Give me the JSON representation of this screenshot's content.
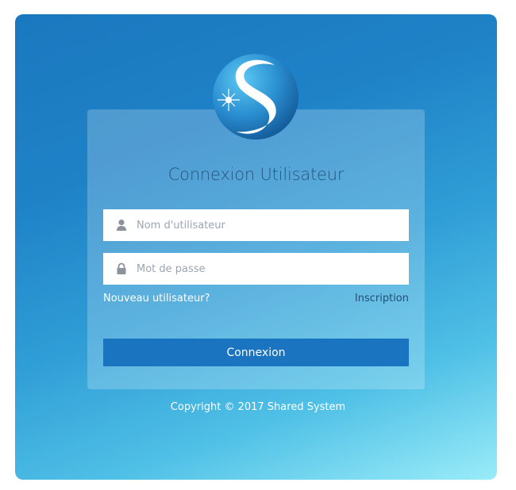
{
  "login": {
    "title": "Connexion Utilisateur",
    "username_placeholder": "Nom d'utilisateur",
    "password_placeholder": "Mot de passe",
    "new_user_link": "Nouveau utilisateur?",
    "signup_link": "Inscription",
    "submit_label": "Connexion"
  },
  "footer": {
    "copyright": "Copyright © 2017 Shared System"
  },
  "icons": {
    "username": "user-icon",
    "password": "lock-icon",
    "logo": "shared-system-s-logo"
  },
  "colors": {
    "background_top": "#1a78bf",
    "background_bottom": "#9aecf8",
    "button": "#1b74bf",
    "title": "#27577f"
  }
}
